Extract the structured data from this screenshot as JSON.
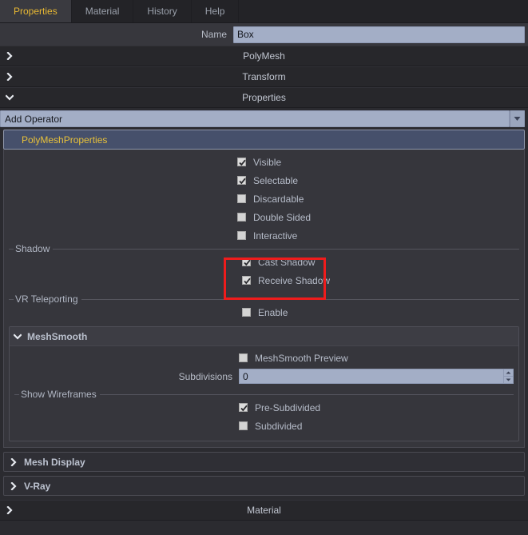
{
  "tabs": [
    {
      "label": "Properties",
      "active": true
    },
    {
      "label": "Material",
      "active": false
    },
    {
      "label": "History",
      "active": false
    },
    {
      "label": "Help",
      "active": false
    }
  ],
  "name_row": {
    "label": "Name",
    "value": "Box"
  },
  "sections": [
    {
      "title": "PolyMesh",
      "expanded": false
    },
    {
      "title": "Transform",
      "expanded": false
    },
    {
      "title": "Properties",
      "expanded": true
    }
  ],
  "add_operator": {
    "value": "Add Operator",
    "arrow_icon": "chevron-down-icon"
  },
  "operator": {
    "label": "PolyMeshProperties"
  },
  "options": [
    {
      "label": "Visible",
      "checked": true
    },
    {
      "label": "Selectable",
      "checked": true
    },
    {
      "label": "Discardable",
      "checked": false
    },
    {
      "label": "Double Sided",
      "checked": false
    },
    {
      "label": "Interactive",
      "checked": false
    }
  ],
  "shadow_group": {
    "label": "Shadow",
    "items": [
      {
        "label": "Cast Shadow",
        "checked": true
      },
      {
        "label": "Receive Shadow",
        "checked": true
      }
    ]
  },
  "vr_group": {
    "label": "VR Teleporting",
    "items": [
      {
        "label": "Enable",
        "checked": false
      }
    ]
  },
  "meshsmooth": {
    "title": "MeshSmooth",
    "expanded": true,
    "preview": {
      "label": "MeshSmooth Preview",
      "checked": false
    },
    "subdivisions": {
      "label": "Subdivisions",
      "value": "0"
    },
    "wireframes_group": {
      "label": "Show Wireframes",
      "items": [
        {
          "label": "Pre-Subdivided",
          "checked": true
        },
        {
          "label": "Subdivided",
          "checked": false
        }
      ]
    }
  },
  "collapsed_panels": [
    {
      "title": "Mesh Display"
    },
    {
      "title": "V-Ray"
    }
  ],
  "material_section": {
    "title": "Material",
    "expanded": false
  },
  "annotation": {
    "color": "#ee1c1c",
    "targets": [
      "Cast Shadow",
      "Receive Shadow"
    ]
  }
}
